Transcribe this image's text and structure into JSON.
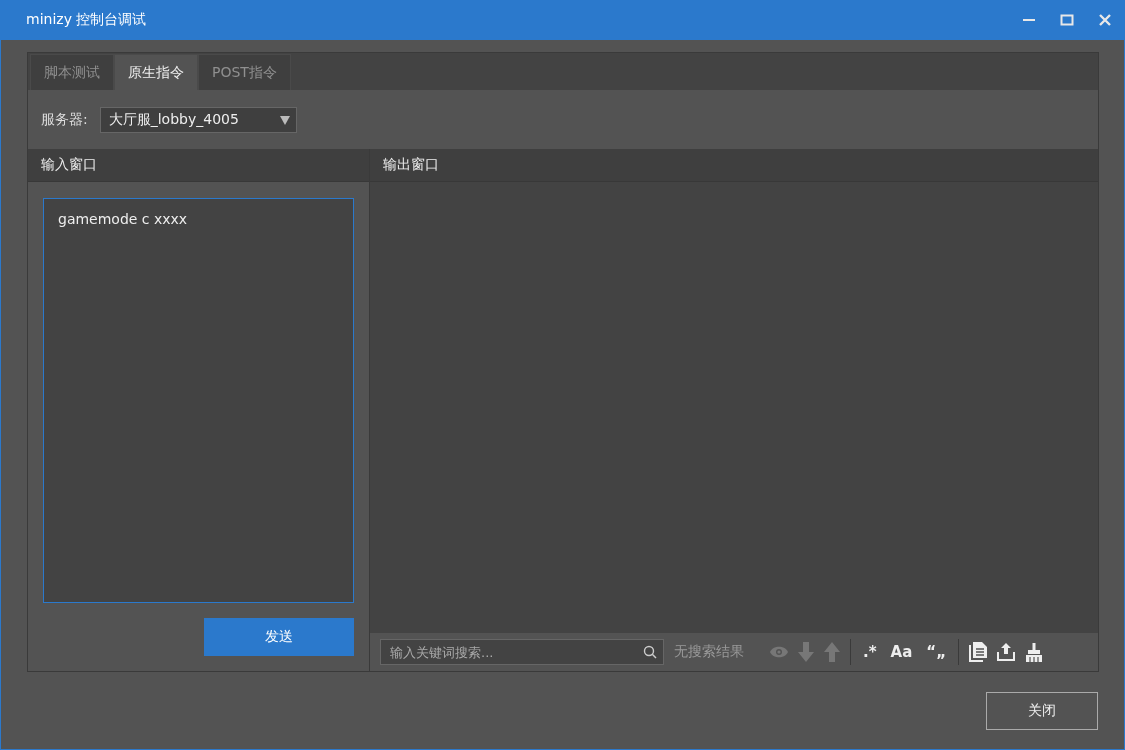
{
  "window": {
    "title": "minizy 控制台调试"
  },
  "tabs": [
    {
      "label": "脚本测试",
      "selected": false
    },
    {
      "label": "原生指令",
      "selected": true
    },
    {
      "label": "POST指令",
      "selected": false
    }
  ],
  "server": {
    "label": "服务器:",
    "value": "大厅服_lobby_4005"
  },
  "input_panel": {
    "title": "输入窗口",
    "value": "gamemode c xxxx",
    "send_button": "发送"
  },
  "output_panel": {
    "title": "输出窗口",
    "search": {
      "placeholder": "输入关键词搜索...",
      "status": "无搜索结果"
    },
    "toggles": [
      {
        "label": ".*"
      },
      {
        "label": "Aa"
      },
      {
        "label": "“„"
      }
    ]
  },
  "close_button": "关闭"
}
